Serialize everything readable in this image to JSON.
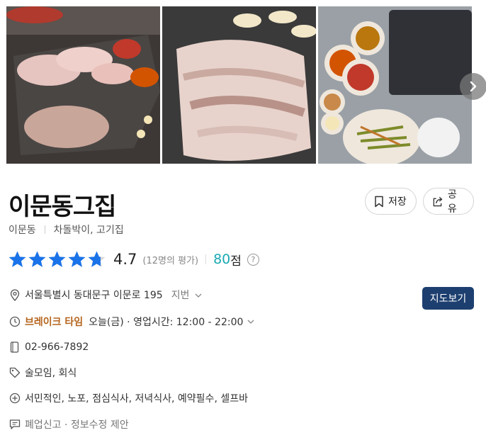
{
  "gallery": {
    "photos": [
      "grilled-pork-belly-on-grill",
      "pork-belly-closeup",
      "side-dishes-and-grill-plate"
    ]
  },
  "place": {
    "name": "이문동그집",
    "area": "이문동",
    "category": "차돌박이, 고기집"
  },
  "actions": {
    "save_label": "저장",
    "share_label": "공유"
  },
  "rating": {
    "score": "4.7",
    "count": "(12명의 평가)",
    "stars": 4.7,
    "points": "80",
    "points_unit": "점",
    "help": "?"
  },
  "info": {
    "address": "서울특별시 동대문구 이문로 195",
    "address_toggle": "지번",
    "map_button": "지도보기",
    "break_label": "브레이크 타임",
    "hours": "오늘(금) · 영업시간: 12:00 - 22:00",
    "phone": "02-966-7892",
    "tags": "술모임, 회식",
    "features": "서민적인, 노포, 점심식사, 저녁식사, 예약필수, 셀프바",
    "report": "폐업신고 · 정보수정 제안"
  },
  "colors": {
    "star": "#1a73e8",
    "points": "#1aa9b3",
    "break": "#b5651d",
    "map_button": "#1d3f70"
  }
}
